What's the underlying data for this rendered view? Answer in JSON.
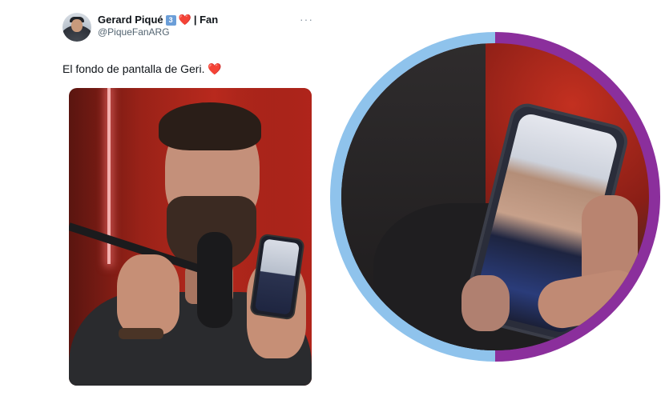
{
  "tweet": {
    "display_name": "Gerard Piqué",
    "verified_number": "3",
    "heart_glyph": "❤️",
    "name_suffix": "| Fan",
    "handle": "@PiqueFanARG",
    "more_icon": "···",
    "text": "El fondo de pantalla de Geri.",
    "text_emoji": "❤️"
  },
  "colors": {
    "ring_left": "#8fc3ec",
    "ring_right": "#8b2f9c",
    "heart": "#e0245e"
  }
}
